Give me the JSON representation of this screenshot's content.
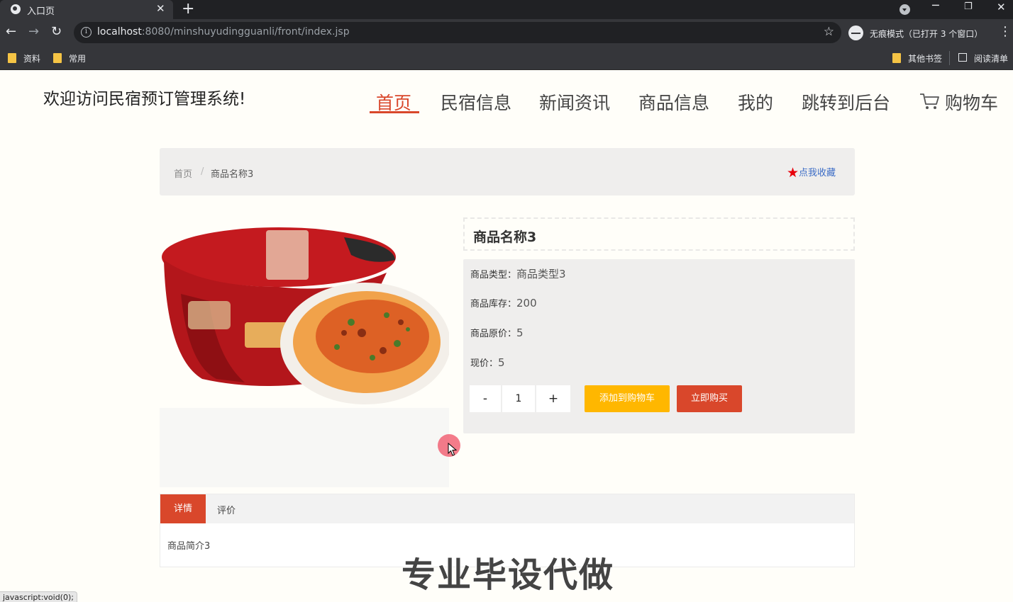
{
  "browser": {
    "tab_title": "入口页",
    "new_tab_symbol": "+",
    "close_symbol": "✕",
    "url_host": "localhost",
    "url_rest": ":8080/minshuyudingguanli/front/index.jsp",
    "incognito_label": "无痕模式（已打开 3 个窗口）",
    "bookmarks": [
      "资料",
      "常用"
    ],
    "other_bookmarks": "其他书签",
    "reading_list": "阅读清单"
  },
  "site": {
    "title": "欢迎访问民宿预订管理系统!",
    "nav": [
      "首页",
      "民宿信息",
      "新闻资讯",
      "商品信息",
      "我的",
      "跳转到后台",
      "购物车"
    ]
  },
  "breadcrumb": {
    "home": "首页",
    "separator": "/",
    "current": "商品名称3",
    "favorite": "点我收藏"
  },
  "product": {
    "name": "商品名称3",
    "type_label": "商品类型：",
    "type_value": "商品类型3",
    "stock_label": "商品库存：",
    "stock_value": "200",
    "original_price_label": "商品原价：",
    "original_price_value": "5",
    "price_label": "现价：",
    "price_value": "5",
    "qty_minus": "-",
    "qty_value": "1",
    "qty_plus": "+",
    "add_to_cart": "添加到购物车",
    "buy_now": "立即购买"
  },
  "tabs": {
    "detail": "详情",
    "review": "评价",
    "content": "商品简介3"
  },
  "overlay": {
    "watermark": "专业毕设代做",
    "status_bar": "javascript:void(0);"
  },
  "colors": {
    "accent_red": "#d9472b",
    "cart_yellow": "#ffb700",
    "favorite_star": "#e8000b"
  }
}
